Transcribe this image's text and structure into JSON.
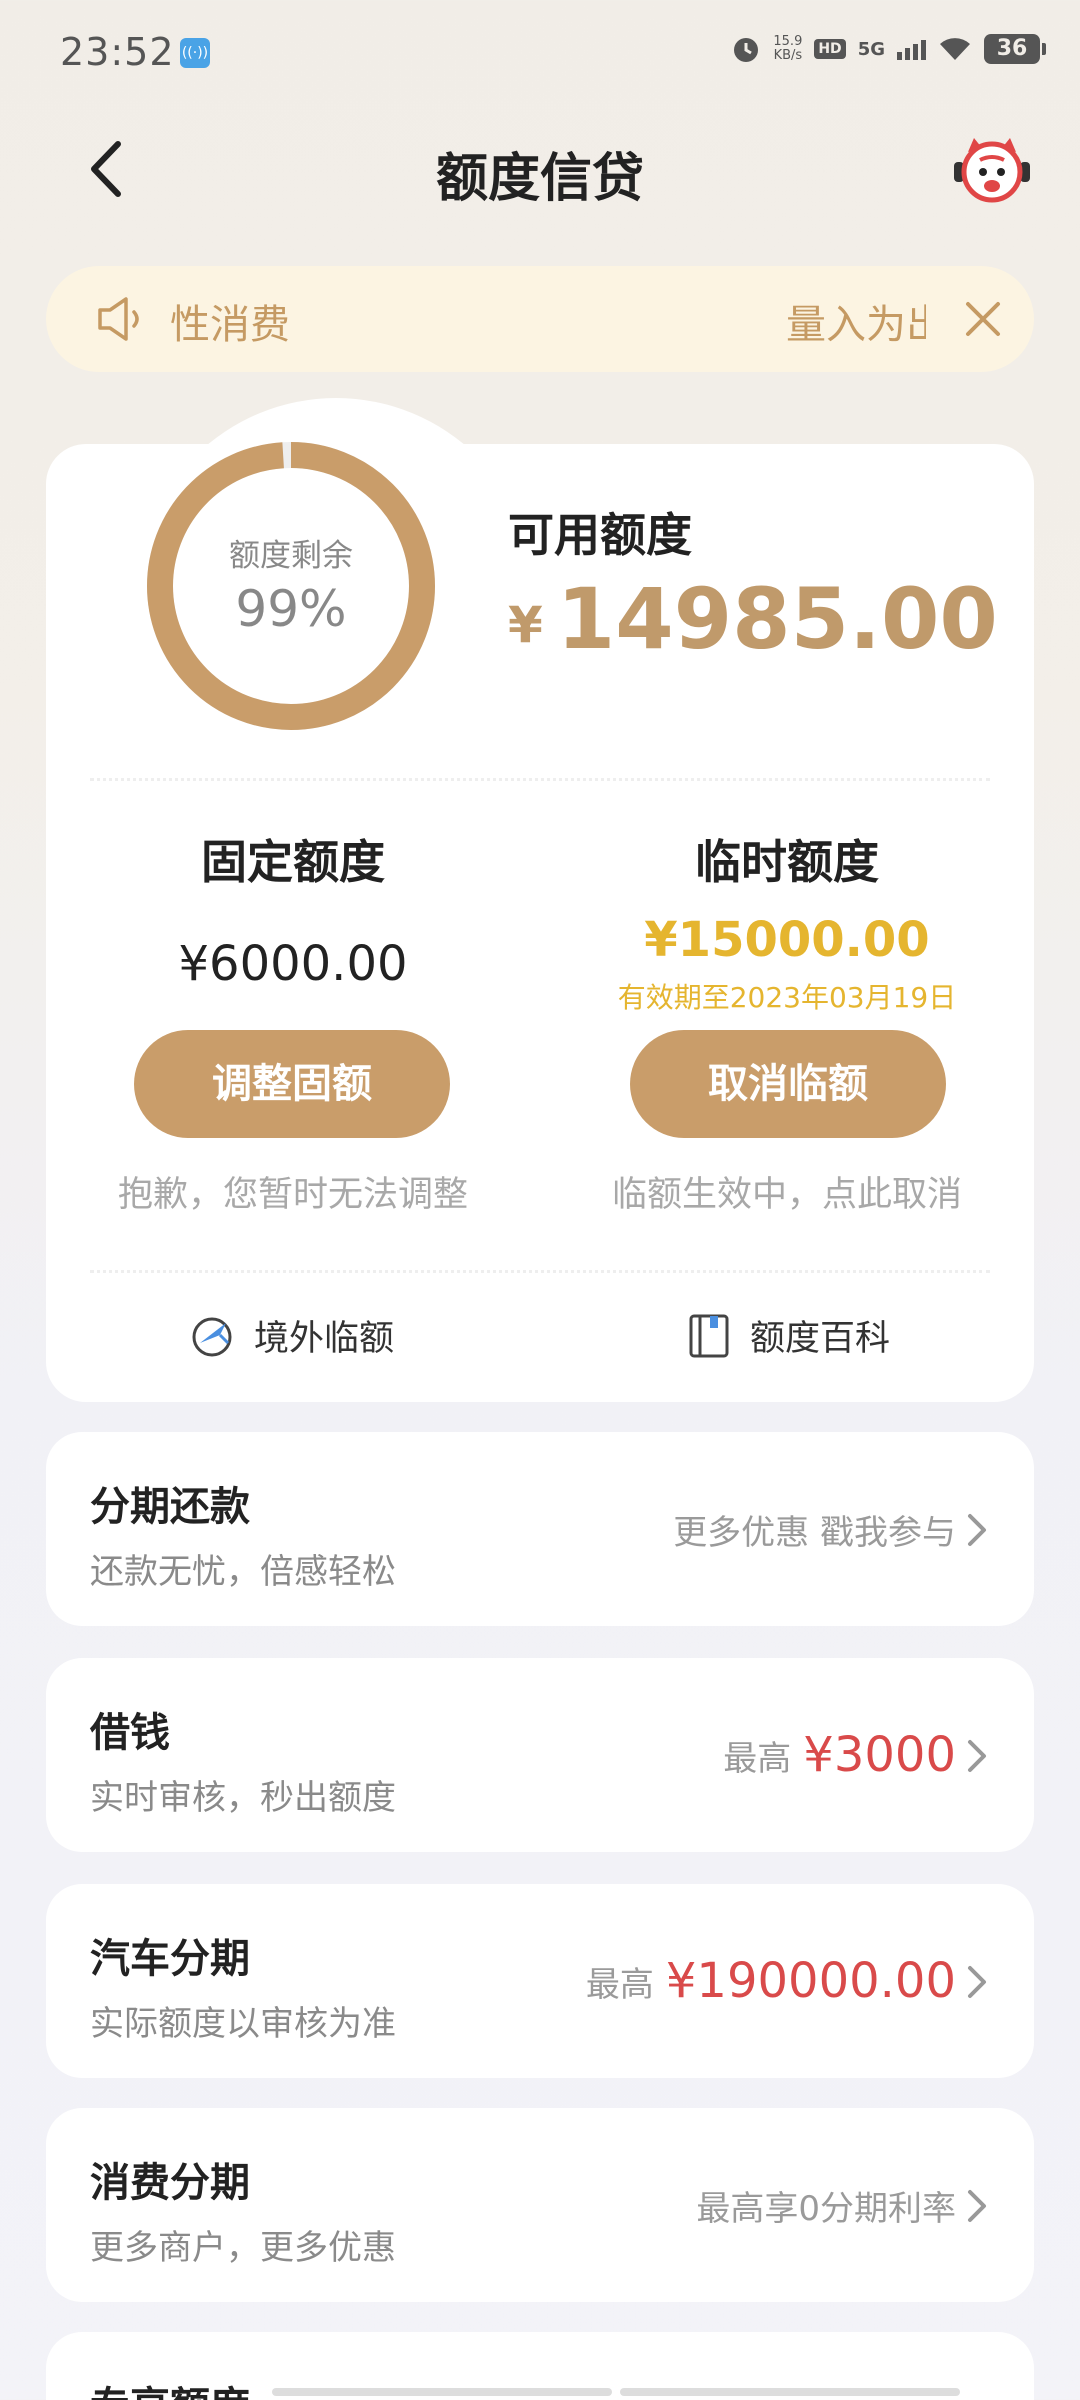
{
  "status_bar": {
    "time": "23:52",
    "net_speed_value": "15.9",
    "net_speed_unit": "KB/s",
    "hd": "HD",
    "signal": "5G",
    "battery": "36"
  },
  "header": {
    "title": "额度信贷"
  },
  "notice": {
    "text_left": "性消费",
    "text_right": "量入为出"
  },
  "credit": {
    "ring_label": "额度剩余",
    "ring_percent": "99%",
    "ring_fraction": 0.99,
    "available_label": "可用额度",
    "currency_symbol": "¥",
    "available_amount": "14985.00",
    "fixed": {
      "title": "固定额度",
      "amount": "¥6000.00",
      "button": "调整固额",
      "hint": "抱歉，您暂时无法调整"
    },
    "temporary": {
      "title": "临时额度",
      "amount": "¥15000.00",
      "expiry": "有效期至2023年03月19日",
      "button": "取消临额",
      "hint": "临额生效中，点此取消"
    },
    "links": {
      "overseas": "境外临额",
      "encyclopedia": "额度百科"
    }
  },
  "list": [
    {
      "title": "分期还款",
      "subtitle": "还款无忧，倍感轻松",
      "right_text": "更多优惠 戳我参与",
      "right_amount": ""
    },
    {
      "title": "借钱",
      "subtitle": "实时审核，秒出额度",
      "right_text": "最高",
      "right_amount": "¥3000"
    },
    {
      "title": "汽车分期",
      "subtitle": "实际额度以审核为准",
      "right_text": "最高",
      "right_amount": "¥190000.00"
    },
    {
      "title": "消费分期",
      "subtitle": "更多商户，更多优惠",
      "right_text": "最高享0分期利率",
      "right_amount": ""
    }
  ],
  "partial_card": {
    "title": "专享额度"
  },
  "colors": {
    "brand_gold": "#c99d6a",
    "temp_yellow": "#e5b52f",
    "price_red": "#d94a4a",
    "notice_bg": "#fcf4e2"
  }
}
